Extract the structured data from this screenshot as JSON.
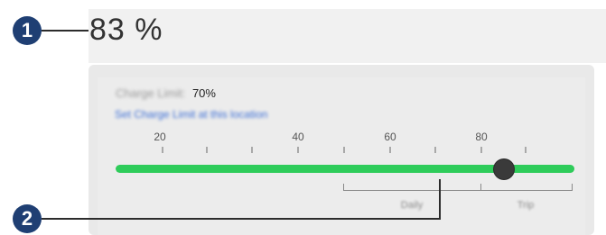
{
  "battery": {
    "percent_text": "83 %"
  },
  "charge_limit": {
    "label": "Charge Limit:",
    "value": "70%",
    "set_location_link": "Set Charge Limit at this location",
    "slider_value_percent": 70,
    "current_charge_percent": 83
  },
  "scale": {
    "ticks": [
      "",
      "20",
      "",
      "40",
      "",
      "60",
      "",
      "80",
      ""
    ]
  },
  "modes": {
    "daily": "Daily",
    "trip": "Trip"
  },
  "callouts": {
    "one": "1",
    "two": "2"
  },
  "colors": {
    "fill": "#2ecc5a",
    "callout": "#1f3f73",
    "link": "#3d6fd6"
  }
}
